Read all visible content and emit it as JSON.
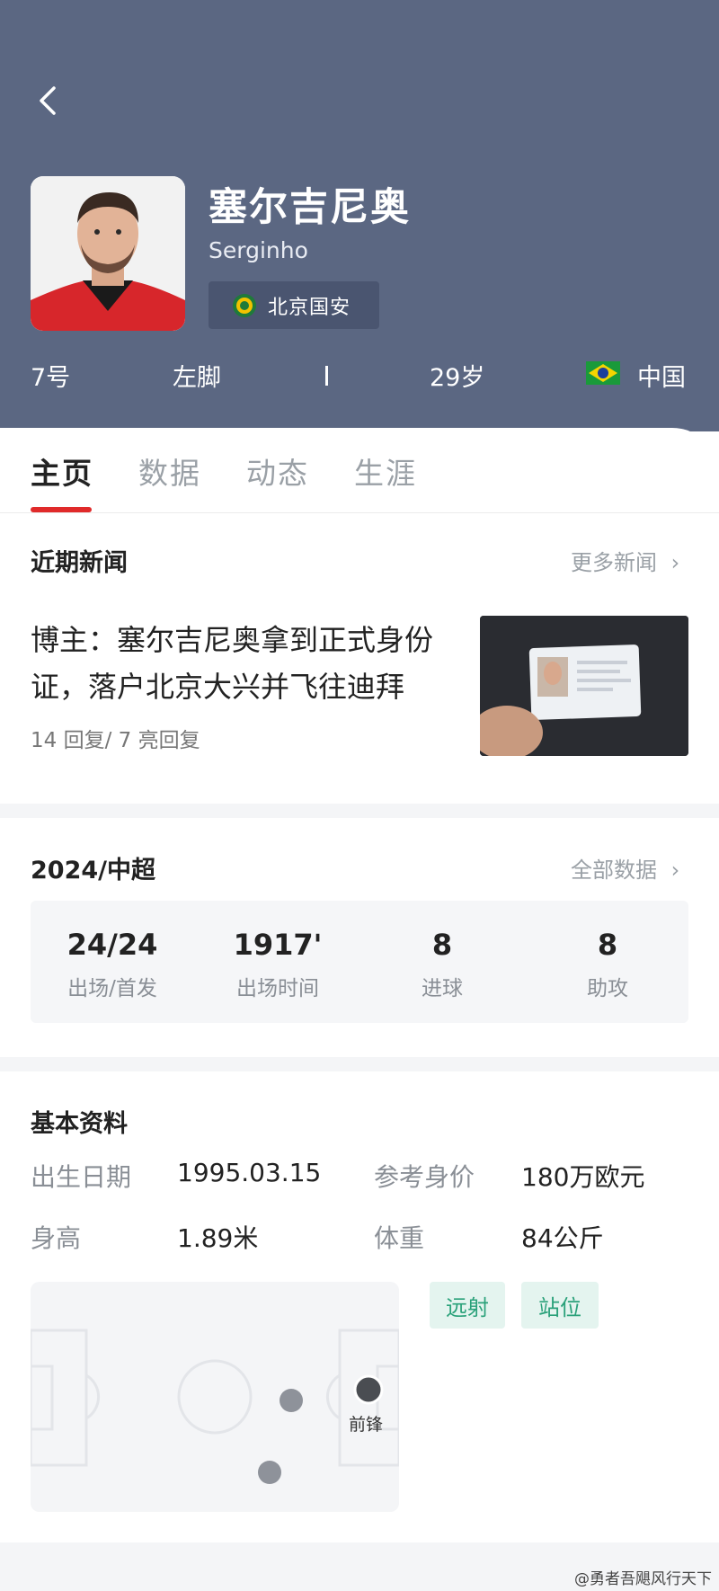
{
  "header": {
    "name": "塞尔吉尼奥",
    "latin_name": "Serginho",
    "team": "北京国安",
    "number": "7号",
    "foot": "左脚",
    "age": "29岁",
    "nationality": "中国",
    "bg_color": "#5b6782"
  },
  "tabs": [
    "主页",
    "数据",
    "动态",
    "生涯"
  ],
  "news": {
    "section_title": "近期新闻",
    "more": "更多新闻",
    "headline": "博主：塞尔吉尼奥拿到正式身份证，落户北京大兴并飞往迪拜",
    "meta": "14 回复/ 7 亮回复"
  },
  "season": {
    "title": "2024/中超",
    "more": "全部数据",
    "stats": [
      {
        "value": "24/24",
        "label": "出场/首发"
      },
      {
        "value": "1917'",
        "label": "出场时间"
      },
      {
        "value": "8",
        "label": "进球"
      },
      {
        "value": "8",
        "label": "助攻"
      }
    ]
  },
  "profile": {
    "title": "基本资料",
    "birth_label": "出生日期",
    "birth_value": "1995.03.15",
    "value_label": "参考身价",
    "value_value": "180万欧元",
    "height_label": "身高",
    "height_value": "1.89米",
    "weight_label": "体重",
    "weight_value": "84公斤",
    "tags": [
      "远射",
      "站位"
    ],
    "position_label": "前锋"
  },
  "watermark": "@勇者吾飓风行天下",
  "colors": {
    "accent": "#e02a2a",
    "tag_green": "#2aa17a"
  }
}
